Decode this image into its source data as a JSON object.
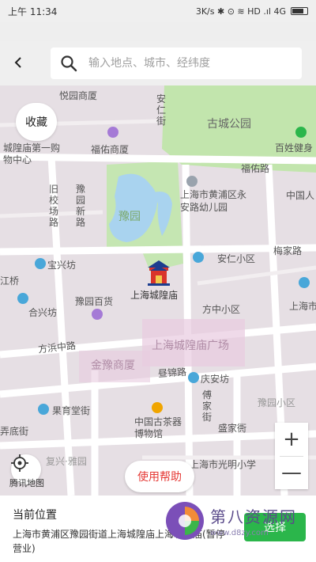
{
  "status_bar": {
    "time": "上午 11:34",
    "indicators": "3K/s ✱ ⊙ ≋ HD .ıl 4G"
  },
  "header": {
    "back_icon": "chevron-left-icon",
    "search_icon": "search-icon",
    "search_placeholder": "输入地点、城市、经纬度"
  },
  "map": {
    "labels": {
      "yueyuan_shangsha": "悦园商厦",
      "anren_jie": "安仁街",
      "gucheng_park": "古城公园",
      "baijia_mall": "百姓健身",
      "fuyou_shangsha": "福佑商厦",
      "chenghuangmiao_1": "城隍庙第一购物中心",
      "fuyou_road": "福佑路",
      "jiuxiao_road": "旧校场路",
      "yuyuan_new_road": "豫园新路",
      "yuyuan": "豫园",
      "kindergarten": "上海市黄浦区永安路幼儿园",
      "zhongguo_ren": "中国人",
      "anren_xiaoqu": "安仁小区",
      "meijia_road": "梅家路",
      "baoxingfang": "宝兴坊",
      "jiangqiao": "江桥",
      "yuyuan_baihuo": "豫园百货",
      "chenghuangmiao": "上海城隍庙",
      "fangzhong_xiaoqu": "方中小区",
      "shanghai_city": "上海市",
      "hexingfang": "合兴坊",
      "fangbang_road": "方浜中路",
      "chenghuangmiao_square": "上海城隍庙广场",
      "jinyu_shangsha": "金豫商厦",
      "jinxiu_road": "昼锦路",
      "qing_anfang": "庆安坊",
      "yuyuan_xiaoqu": "豫园小区",
      "guohuatang_jie": "果育堂街",
      "fujia_jie": "傅家街",
      "tea_museum": "中国古茶器博物馆",
      "shengjia_dong": "盛家衖",
      "fu_xing_yayuan": "复兴·雅园",
      "guangming_school": "上海市光明小学",
      "nongdi_jie": "弄底街"
    },
    "favorite_label": "收藏",
    "help_label": "使用帮助",
    "zoom_in": "+",
    "zoom_out": "—",
    "map_provider": "腾讯地图",
    "locate_icon": "locate-icon",
    "marker_icon": "temple-marker-icon"
  },
  "bottom": {
    "title": "当前位置",
    "address": "上海市黄浦区豫园街道上海城隍庙上海城隍庙(暂停营业)",
    "select_label": "选择"
  },
  "watermark": {
    "title": "第八资源网",
    "url": "www.d8zy.com"
  },
  "colors": {
    "green": "#2bb64b",
    "red": "#e53935",
    "park": "#bfe3a8",
    "water": "#a8d2f0",
    "road": "#ffffff",
    "block": "#e3dbe0"
  }
}
